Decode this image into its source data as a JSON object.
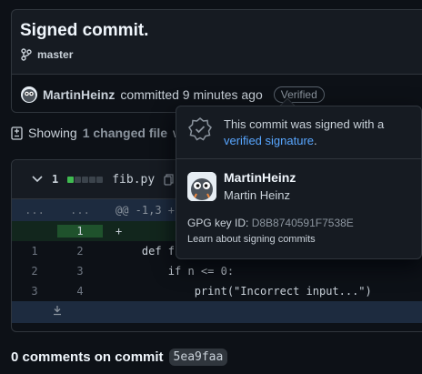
{
  "commit": {
    "title": "Signed commit.",
    "branch": "master",
    "author": "MartinHeinz",
    "committed_text": "committed 9 minutes ago",
    "verified_label": "Verified"
  },
  "summary": {
    "prefix": "Showing",
    "changed": "1 changed file",
    "suffix": "w"
  },
  "diff": {
    "count": "1",
    "filename": "fib.py",
    "hunk": "@@ -1,3 +1,",
    "hunk_left": "...",
    "hunk_right": "...",
    "rows": [
      {
        "old": "",
        "new": "1",
        "code": "+",
        "added": true
      },
      {
        "old": "1",
        "new": "2",
        "code": "    def fibo",
        "added": false
      },
      {
        "old": "2",
        "new": "3",
        "code": "        if n <= 0:",
        "added": false
      },
      {
        "old": "3",
        "new": "4",
        "code": "            print(\"Incorrect input...\")",
        "added": false
      }
    ]
  },
  "comments": {
    "label": "0 comments on commit",
    "sha": "5ea9faa"
  },
  "popover": {
    "message_prefix": "This commit was signed with a",
    "message_link": "verified signature",
    "message_suffix": ".",
    "login": "MartinHeinz",
    "name": "Martin Heinz",
    "gpg_label": "GPG key ID:",
    "gpg_key": "D8B8740591F7538E",
    "learn": "Learn about signing commits"
  },
  "colors": {
    "background": "#0d1117",
    "panel": "#161b22",
    "border": "#30363d",
    "link": "#58a6ff",
    "added": "#3fb950"
  }
}
